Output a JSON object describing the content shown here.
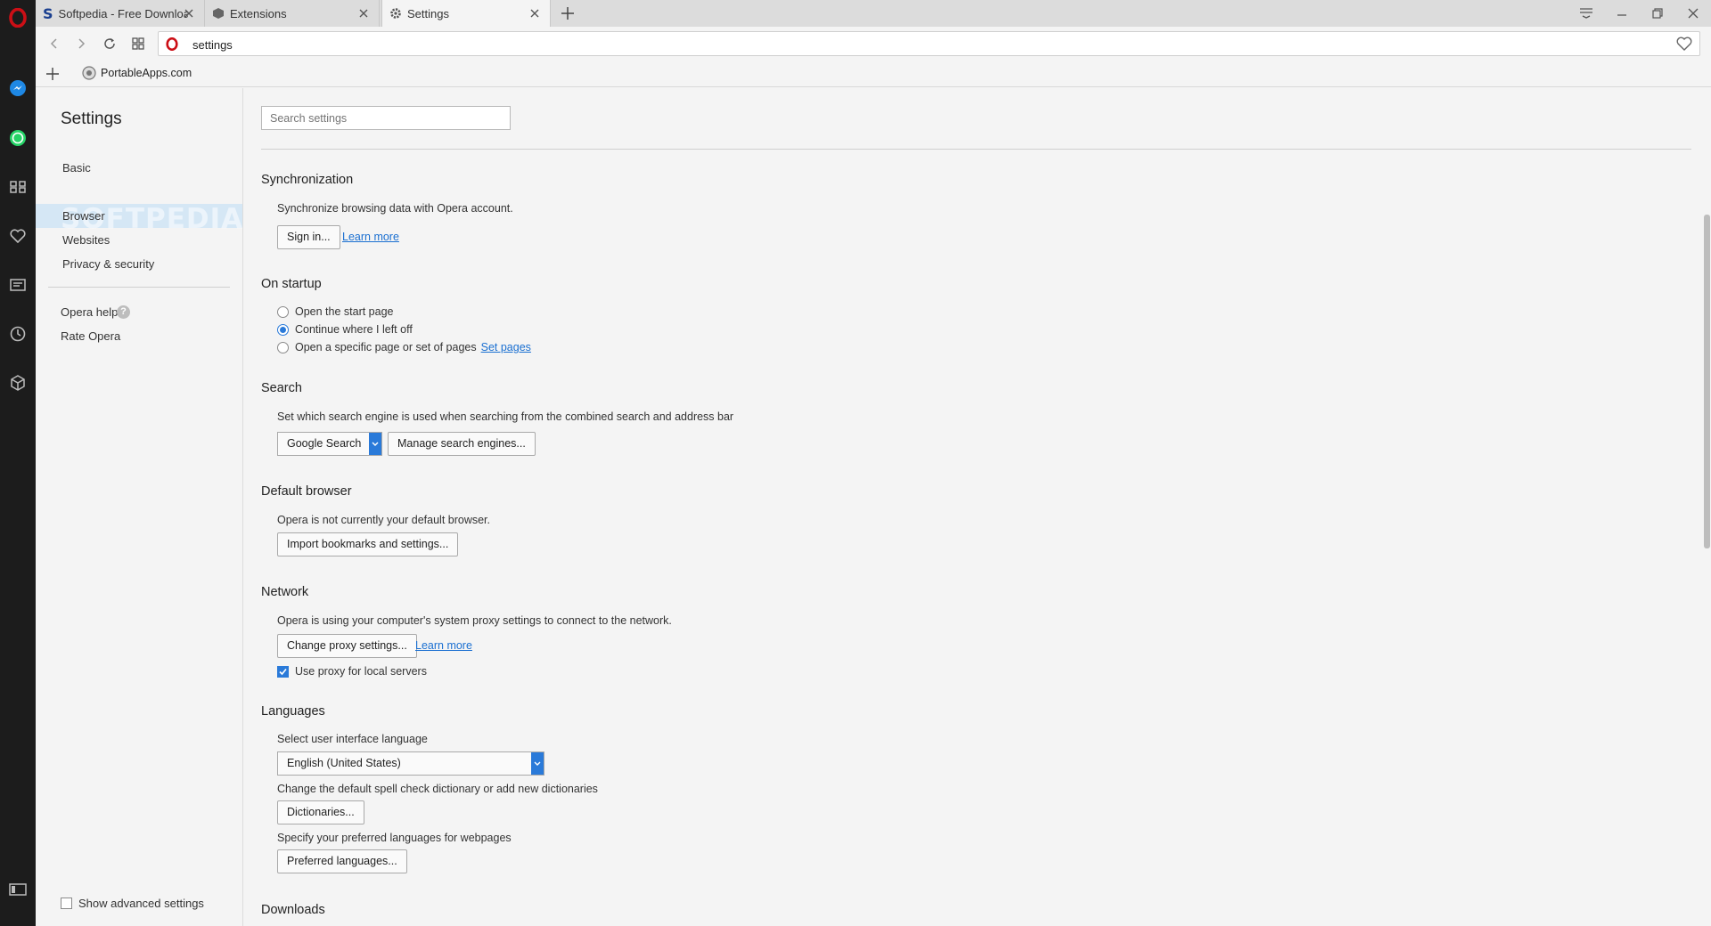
{
  "tabs": [
    {
      "title": "Softpedia - Free Download",
      "icon": "softpedia-s-icon"
    },
    {
      "title": "Extensions",
      "icon": "cube-icon"
    },
    {
      "title": "Settings",
      "icon": "gear-icon"
    }
  ],
  "address": {
    "url": "settings"
  },
  "bookmarks": [
    {
      "label": "PortableApps.com"
    }
  ],
  "sidebar_icons": [
    "opera-logo-icon",
    "messenger-icon",
    "whatsapp-icon",
    "speed-dial-icon",
    "heart-icon",
    "news-icon",
    "history-icon",
    "extensions-icon",
    "sidebar-toggle-icon"
  ],
  "settings_nav": {
    "title": "Settings",
    "items": [
      "Basic",
      "Browser",
      "Websites",
      "Privacy & security"
    ],
    "selected": "Browser",
    "help": "Opera help",
    "rate": "Rate Opera",
    "advanced": "Show advanced settings",
    "watermark": "SOFTPEDIA"
  },
  "search": {
    "placeholder": "Search settings"
  },
  "sections": {
    "sync": {
      "title": "Synchronization",
      "desc": "Synchronize browsing data with Opera account.",
      "sign_in": "Sign in...",
      "learn_more": "Learn more"
    },
    "startup": {
      "title": "On startup",
      "options": [
        "Open the start page",
        "Continue where I left off",
        "Open a specific page or set of pages"
      ],
      "selected_index": 1,
      "set_pages": "Set pages"
    },
    "search": {
      "title": "Search",
      "desc": "Set which search engine is used when searching from the combined search and address bar",
      "engine": "Google Search",
      "manage": "Manage search engines..."
    },
    "default_browser": {
      "title": "Default browser",
      "desc": "Opera is not currently your default browser.",
      "import": "Import bookmarks and settings..."
    },
    "network": {
      "title": "Network",
      "desc": "Opera is using your computer's system proxy settings to connect to the network.",
      "proxy_btn": "Change proxy settings...",
      "learn_more": "Learn more",
      "local_proxy": "Use proxy for local servers",
      "local_proxy_checked": true
    },
    "languages": {
      "title": "Languages",
      "ui_label": "Select user interface language",
      "ui_value": "English (United States)",
      "spell_label": "Change the default spell check dictionary or add new dictionaries",
      "dict_btn": "Dictionaries...",
      "pref_label": "Specify your preferred languages for webpages",
      "pref_btn": "Preferred languages..."
    },
    "downloads": {
      "title": "Downloads"
    }
  },
  "colors": {
    "accent": "#2a7ad9",
    "link": "#1a6fd1",
    "sidebar": "#1c1c1c",
    "opera_red": "#cc0f16",
    "nav_selected": "#d5e7f5"
  }
}
